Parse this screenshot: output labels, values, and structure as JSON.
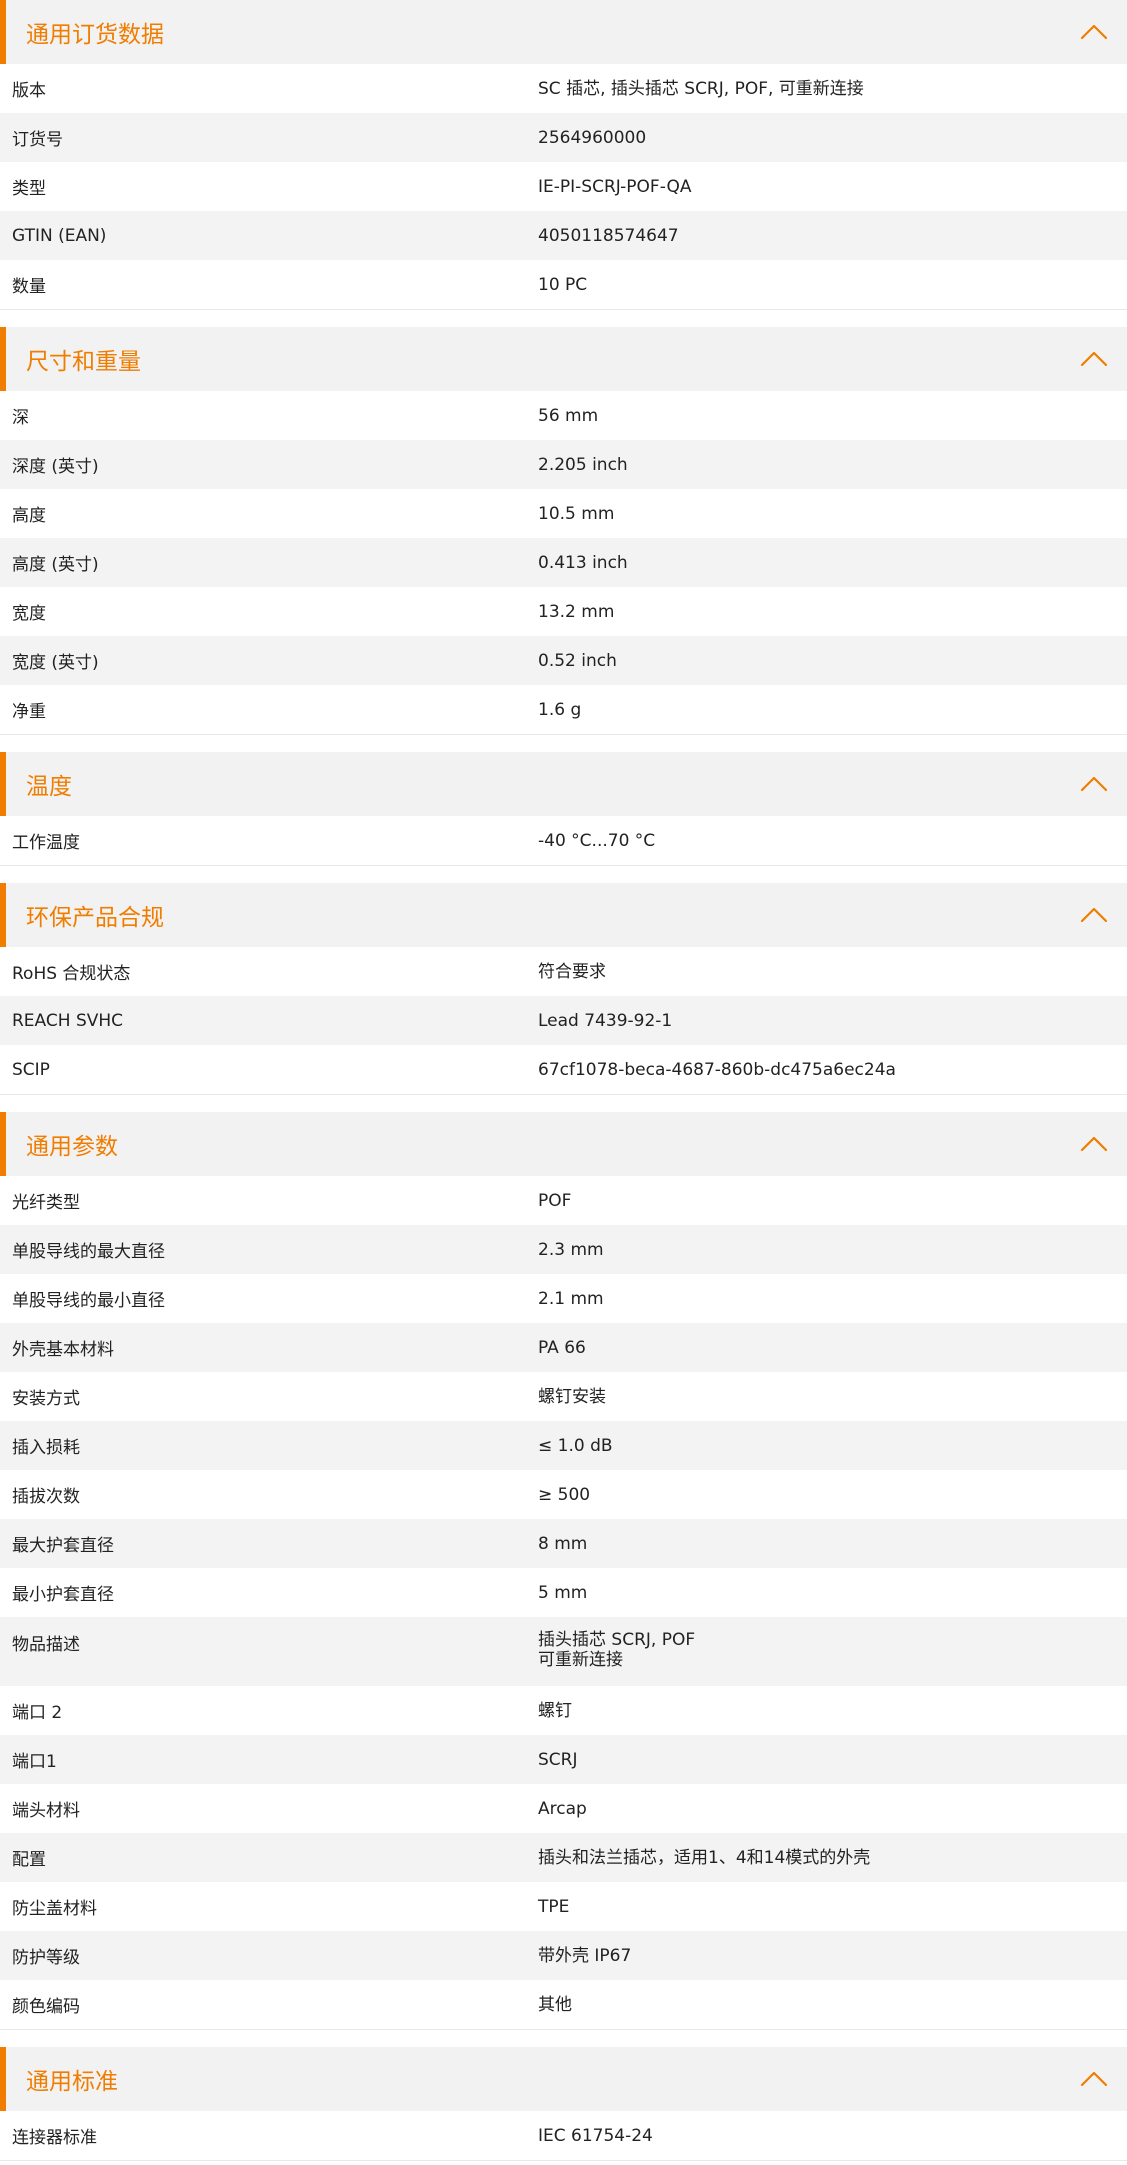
{
  "colors": {
    "accent": "#f07d00",
    "header_bg": "#f2f2f2",
    "row_alt_bg": "#f3f3f3",
    "text": "#222222"
  },
  "icons": {
    "collapse": "chevron-up-icon"
  },
  "sections": [
    {
      "title": "通用订货数据",
      "rows": [
        {
          "label": "版本",
          "value": "SC 插芯, 插头插芯 SCRJ, POF, 可重新连接"
        },
        {
          "label": "订货号",
          "value": "2564960000"
        },
        {
          "label": "类型",
          "value": "IE-PI-SCRJ-POF-QA"
        },
        {
          "label": "GTIN (EAN)",
          "value": "4050118574647"
        },
        {
          "label": "数量",
          "value": "10  PC"
        }
      ]
    },
    {
      "title": "尺寸和重量",
      "rows": [
        {
          "label": "深",
          "value": "56  mm"
        },
        {
          "label": "深度 (英寸)",
          "value": "2.205  inch"
        },
        {
          "label": "高度",
          "value": "10.5  mm"
        },
        {
          "label": "高度 (英寸)",
          "value": "0.413  inch"
        },
        {
          "label": "宽度",
          "value": "13.2  mm"
        },
        {
          "label": "宽度 (英寸)",
          "value": "0.52  inch"
        },
        {
          "label": "净重",
          "value": "1.6  g"
        }
      ]
    },
    {
      "title": "温度",
      "rows": [
        {
          "label": "工作温度",
          "value": "-40 °C...70 °C"
        }
      ]
    },
    {
      "title": "环保产品合规",
      "rows": [
        {
          "label": "RoHS 合规状态",
          "value": "符合要求"
        },
        {
          "label": "REACH SVHC",
          "value": "Lead 7439-92-1"
        },
        {
          "label": "SCIP",
          "value": "67cf1078-beca-4687-860b-dc475a6ec24a"
        }
      ]
    },
    {
      "title": "通用参数",
      "rows": [
        {
          "label": "光纤类型",
          "value": "POF"
        },
        {
          "label": "单股导线的最大直径",
          "value": "2.3  mm"
        },
        {
          "label": "单股导线的最小直径",
          "value": "2.1  mm"
        },
        {
          "label": "外壳基本材料",
          "value": "PA 66"
        },
        {
          "label": "安装方式",
          "value": "螺钉安装"
        },
        {
          "label": "插入损耗",
          "value": "≤ 1.0 dB"
        },
        {
          "label": "插拔次数",
          "value": "≥ 500"
        },
        {
          "label": "最大护套直径",
          "value": "8  mm"
        },
        {
          "label": "最小护套直径",
          "value": "5  mm"
        },
        {
          "label": "物品描述",
          "value": "插头插芯 SCRJ, POF\n可重新连接"
        },
        {
          "label": "端口 2",
          "value": "螺钉"
        },
        {
          "label": "端口1",
          "value": "SCRJ"
        },
        {
          "label": "端头材料",
          "value": "Arcap"
        },
        {
          "label": "配置",
          "value": "插头和法兰插芯，适用1、4和14模式的外壳"
        },
        {
          "label": "防尘盖材料",
          "value": "TPE"
        },
        {
          "label": "防护等级",
          "value": "带外壳 IP67"
        },
        {
          "label": "颜色编码",
          "value": "其他"
        }
      ]
    },
    {
      "title": "通用标准",
      "rows": [
        {
          "label": "连接器标准",
          "value": "IEC 61754-24"
        }
      ]
    }
  ]
}
